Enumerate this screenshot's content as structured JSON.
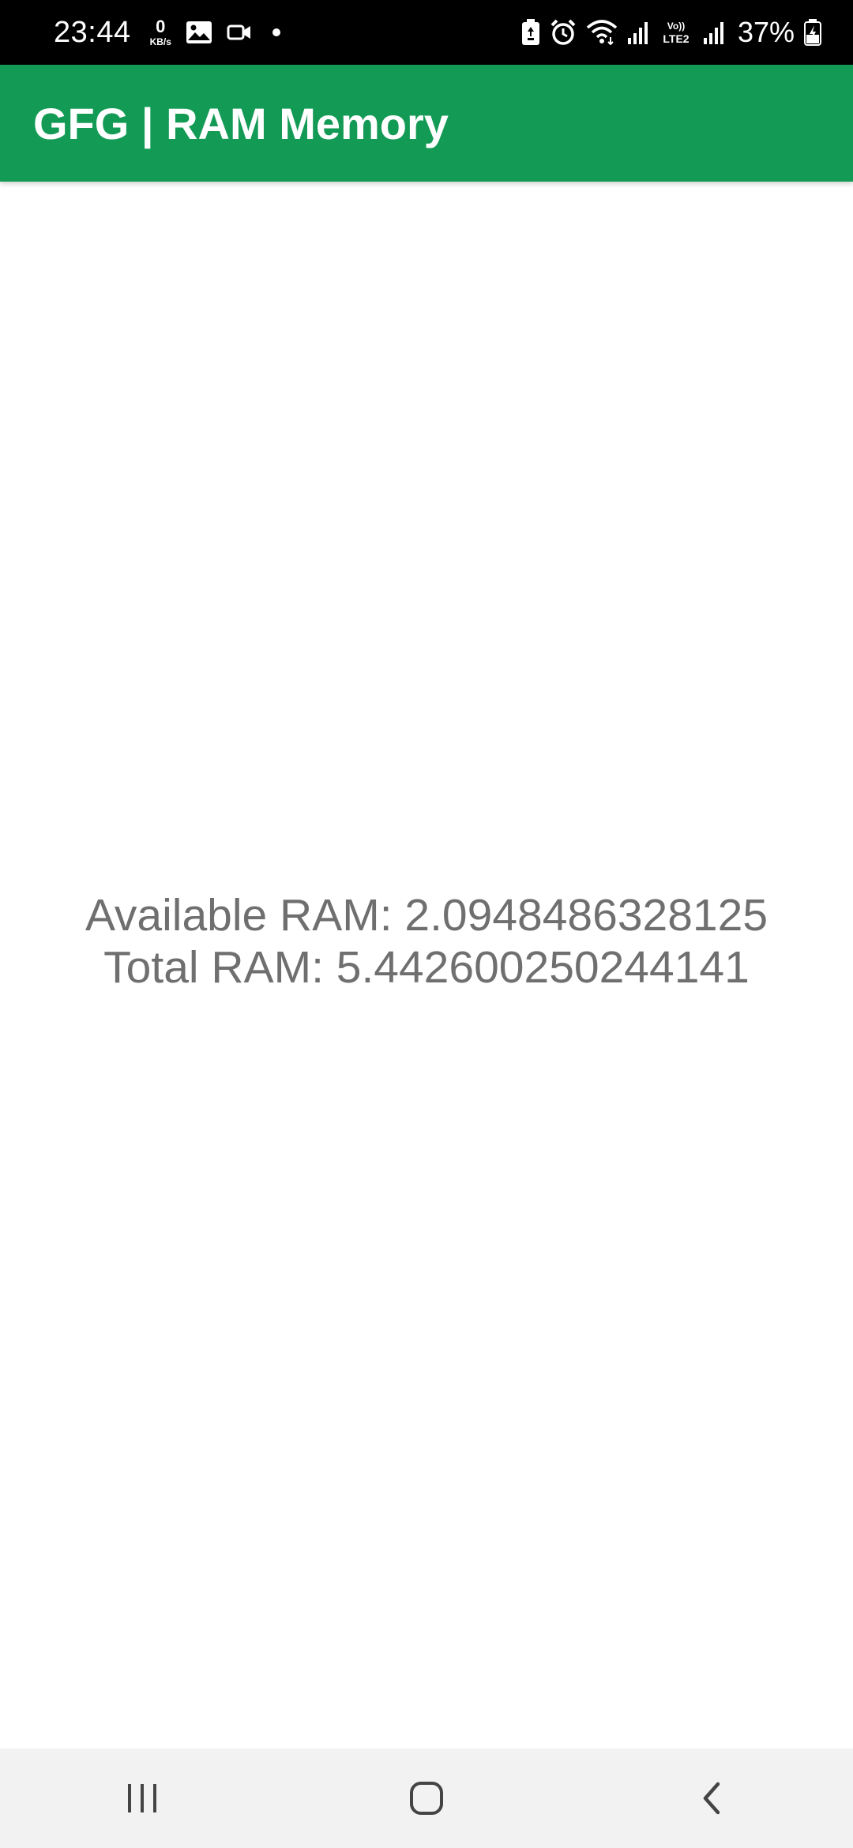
{
  "status_bar": {
    "time": "23:44",
    "net_speed_value": "0",
    "net_speed_unit": "KB/s",
    "battery_percent": "37%",
    "icons": [
      "gallery-icon",
      "video-icon",
      "notification-dot",
      "battery-saver-icon",
      "alarm-icon",
      "wifi-icon",
      "signal-icon",
      "volte-lte2-icon",
      "signal-icon-2",
      "battery-charging-icon"
    ]
  },
  "app_bar": {
    "title": "GFG | RAM Memory",
    "background_color": "#139b55"
  },
  "main": {
    "available_ram": "Available RAM: 2.0948486328125",
    "total_ram": "Total RAM: 5.442600250244141",
    "text_color": "#6f6f6f"
  },
  "nav_bar": {
    "buttons": [
      "recents-icon",
      "home-icon",
      "back-icon"
    ]
  }
}
